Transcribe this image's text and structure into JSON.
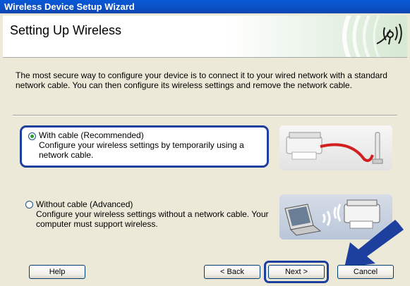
{
  "window": {
    "title": "Wireless Device Setup Wizard"
  },
  "header": {
    "title": "Setting Up Wireless"
  },
  "intro": "The most secure way to configure your device is to connect it to your wired network with a standard network cable. You can then configure its wireless settings and remove the network cable.",
  "options": [
    {
      "label": "With cable (Recommended)",
      "description": "Configure your wireless settings by temporarily using a network cable.",
      "selected": true
    },
    {
      "label": "Without cable (Advanced)",
      "description": "Configure your wireless settings without a network cable. Your computer must support wireless.",
      "selected": false
    }
  ],
  "buttons": {
    "help": "Help",
    "back": "< Back",
    "next": "Next >",
    "cancel": "Cancel"
  },
  "colors": {
    "titlebar": "#0a58d6",
    "highlight": "#1d3f9e",
    "radio_dot": "#2c9e2c"
  }
}
